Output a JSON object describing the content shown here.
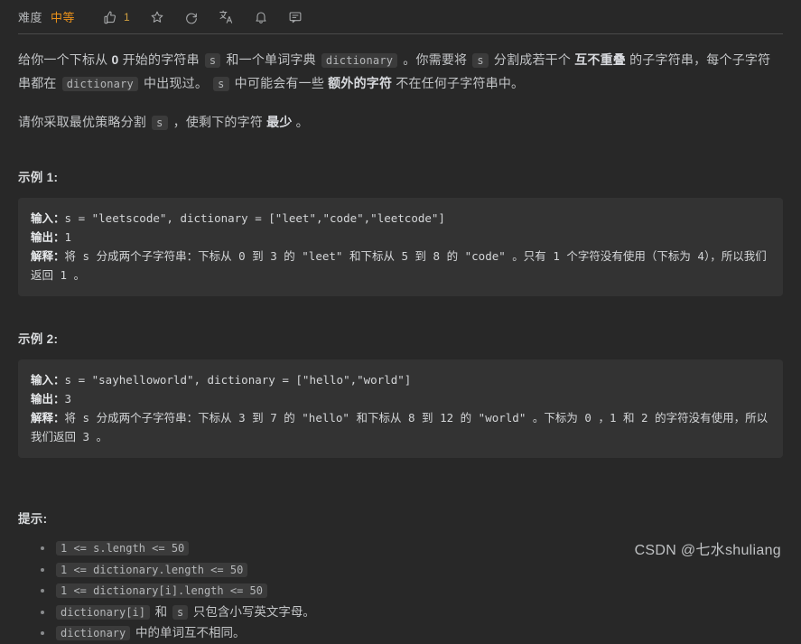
{
  "header": {
    "difficulty_label": "难度",
    "difficulty_value": "中等",
    "difficulty_color": "#e8901a",
    "actions": [
      {
        "name": "thumbs-up-icon",
        "count": "1"
      },
      {
        "name": "star-icon",
        "count": ""
      },
      {
        "name": "refresh-icon",
        "count": ""
      },
      {
        "name": "translate-icon",
        "count": ""
      },
      {
        "name": "bell-icon",
        "count": ""
      },
      {
        "name": "comment-icon",
        "count": ""
      }
    ]
  },
  "description": {
    "p1": {
      "t1": "给你一个下标从 ",
      "b1": "0",
      "t2": " 开始的字符串 ",
      "c1": "s",
      "t3": " 和一个单词字典 ",
      "c2": "dictionary",
      "t4": " 。你需要将 ",
      "c3": "s",
      "t5": " 分割成若干个 ",
      "b2": "互不重叠",
      "t6": " 的子字符串，每个子字符串都在 ",
      "c4": "dictionary",
      "t7": " 中出现过。 ",
      "c5": "s",
      "t8": " 中可能会有一些 ",
      "b3": "额外的字符",
      "t9": " 不在任何子字符串中。"
    },
    "p2": {
      "t1": "请你采取最优策略分割 ",
      "c1": "s",
      "t2": " ，使剩下的字符 ",
      "b1": "最少",
      "t3": " 。"
    }
  },
  "examples": [
    {
      "title": "示例 1:",
      "input_label": "输入：",
      "input_value": "s = \"leetscode\", dictionary = [\"leet\",\"code\",\"leetcode\"]",
      "output_label": "输出：",
      "output_value": "1",
      "explain_label": "解释：",
      "explain_value": "将 s 分成两个子字符串：下标从 0 到 3 的 \"leet\" 和下标从 5 到 8 的 \"code\" 。只有 1 个字符没有使用（下标为 4），所以我们返回 1 。"
    },
    {
      "title": "示例 2:",
      "input_label": "输入：",
      "input_value": "s = \"sayhelloworld\", dictionary = [\"hello\",\"world\"]",
      "output_label": "输出：",
      "output_value": "3",
      "explain_label": "解释：",
      "explain_value": "将 s 分成两个子字符串：下标从 3 到 7 的 \"hello\" 和下标从 8 到 12 的 \"world\" 。下标为 0 ，1 和 2 的字符没有使用，所以我们返回 3 。"
    }
  ],
  "hints": {
    "title": "提示:",
    "items": [
      {
        "code": "1 <= s.length <= 50",
        "text": ""
      },
      {
        "code": "1 <= dictionary.length <= 50",
        "text": ""
      },
      {
        "code": "1 <= dictionary[i].length <= 50",
        "text": ""
      },
      {
        "code": "dictionary[i]",
        "mid": " 和 ",
        "code2": "s",
        "text": " 只包含小写英文字母。"
      },
      {
        "code": "dictionary",
        "text": " 中的单词互不相同。"
      }
    ]
  },
  "watermark": "CSDN @七水shuliang"
}
